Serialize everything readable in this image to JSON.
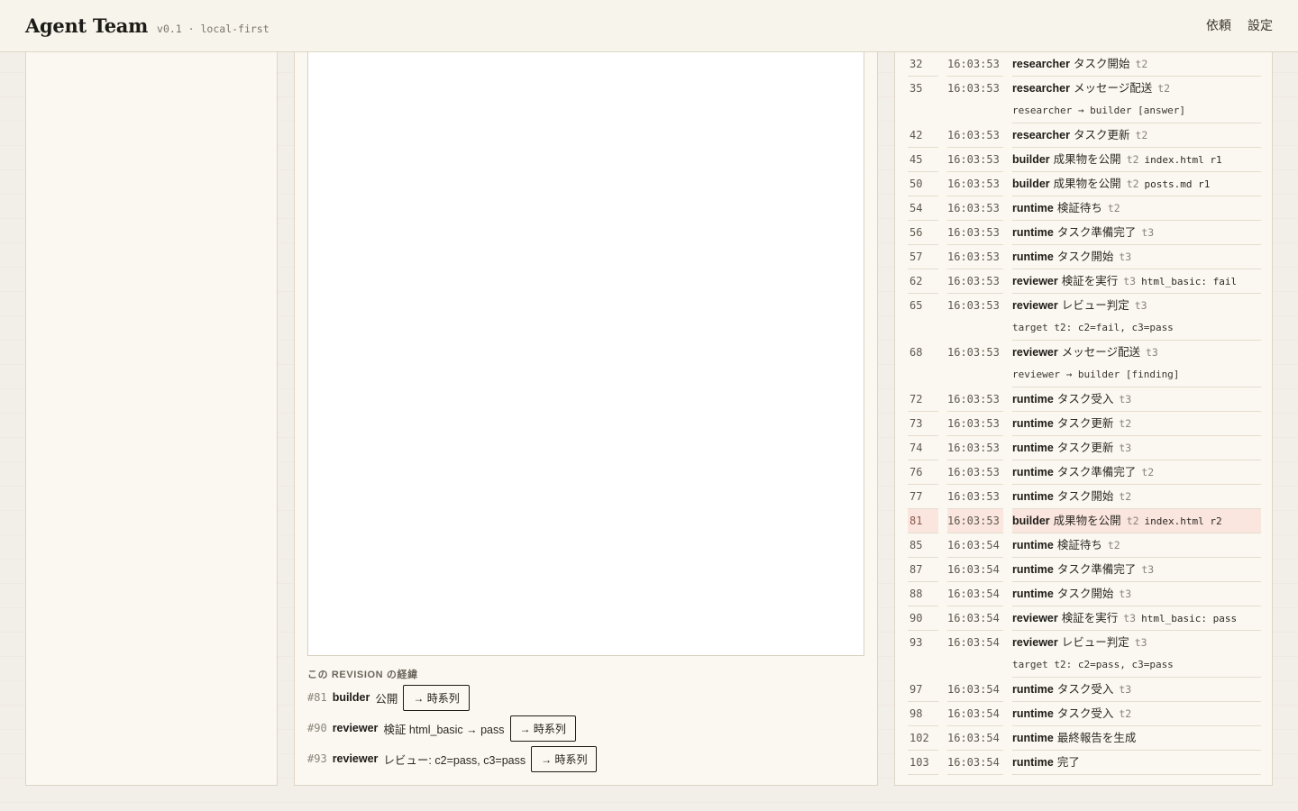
{
  "header": {
    "brand": "Agent Team",
    "version": "v0.1 · local-first",
    "nav": [
      "依頼",
      "設定"
    ]
  },
  "history": {
    "title": "この REVISION の経緯",
    "items": [
      {
        "num": "#81",
        "actor": "builder",
        "desc": "公開",
        "button": "→ 時系列"
      },
      {
        "num": "#90",
        "actor": "reviewer",
        "desc": "検証 html_basic → pass",
        "button": "→ 時系列"
      },
      {
        "num": "#93",
        "actor": "reviewer",
        "desc": "レビュー: c2=pass, c3=pass",
        "button": "→ 時系列"
      }
    ]
  },
  "log": [
    {
      "seq": "32",
      "time": "16:03:53",
      "actor": "researcher",
      "action": "タスク開始",
      "task": "t2",
      "extra": "",
      "detail": ""
    },
    {
      "seq": "35",
      "time": "16:03:53",
      "actor": "researcher",
      "action": "メッセージ配送",
      "task": "t2",
      "extra": "",
      "detail": "researcher → builder [answer]"
    },
    {
      "seq": "42",
      "time": "16:03:53",
      "actor": "researcher",
      "action": "タスク更新",
      "task": "t2",
      "extra": "",
      "detail": ""
    },
    {
      "seq": "45",
      "time": "16:03:53",
      "actor": "builder",
      "action": "成果物を公開",
      "task": "t2",
      "extra": "index.html r1",
      "detail": ""
    },
    {
      "seq": "50",
      "time": "16:03:53",
      "actor": "builder",
      "action": "成果物を公開",
      "task": "t2",
      "extra": "posts.md r1",
      "detail": ""
    },
    {
      "seq": "54",
      "time": "16:03:53",
      "actor": "runtime",
      "action": "検証待ち",
      "task": "t2",
      "extra": "",
      "detail": ""
    },
    {
      "seq": "56",
      "time": "16:03:53",
      "actor": "runtime",
      "action": "タスク準備完了",
      "task": "t3",
      "extra": "",
      "detail": ""
    },
    {
      "seq": "57",
      "time": "16:03:53",
      "actor": "runtime",
      "action": "タスク開始",
      "task": "t3",
      "extra": "",
      "detail": ""
    },
    {
      "seq": "62",
      "time": "16:03:53",
      "actor": "reviewer",
      "action": "検証を実行",
      "task": "t3",
      "extra": "html_basic: fail",
      "detail": ""
    },
    {
      "seq": "65",
      "time": "16:03:53",
      "actor": "reviewer",
      "action": "レビュー判定",
      "task": "t3",
      "extra": "",
      "detail": "target t2: c2=fail, c3=pass"
    },
    {
      "seq": "68",
      "time": "16:03:53",
      "actor": "reviewer",
      "action": "メッセージ配送",
      "task": "t3",
      "extra": "",
      "detail": "reviewer → builder [finding]"
    },
    {
      "seq": "72",
      "time": "16:03:53",
      "actor": "runtime",
      "action": "タスク受入",
      "task": "t3",
      "extra": "",
      "detail": ""
    },
    {
      "seq": "73",
      "time": "16:03:53",
      "actor": "runtime",
      "action": "タスク更新",
      "task": "t2",
      "extra": "",
      "detail": ""
    },
    {
      "seq": "74",
      "time": "16:03:53",
      "actor": "runtime",
      "action": "タスク更新",
      "task": "t3",
      "extra": "",
      "detail": ""
    },
    {
      "seq": "76",
      "time": "16:03:53",
      "actor": "runtime",
      "action": "タスク準備完了",
      "task": "t2",
      "extra": "",
      "detail": ""
    },
    {
      "seq": "77",
      "time": "16:03:53",
      "actor": "runtime",
      "action": "タスク開始",
      "task": "t2",
      "extra": "",
      "detail": ""
    },
    {
      "seq": "81",
      "time": "16:03:53",
      "actor": "builder",
      "action": "成果物を公開",
      "task": "t2",
      "extra": "index.html r2",
      "detail": "",
      "highlight": true
    },
    {
      "seq": "85",
      "time": "16:03:54",
      "actor": "runtime",
      "action": "検証待ち",
      "task": "t2",
      "extra": "",
      "detail": ""
    },
    {
      "seq": "87",
      "time": "16:03:54",
      "actor": "runtime",
      "action": "タスク準備完了",
      "task": "t3",
      "extra": "",
      "detail": ""
    },
    {
      "seq": "88",
      "time": "16:03:54",
      "actor": "runtime",
      "action": "タスク開始",
      "task": "t3",
      "extra": "",
      "detail": ""
    },
    {
      "seq": "90",
      "time": "16:03:54",
      "actor": "reviewer",
      "action": "検証を実行",
      "task": "t3",
      "extra": "html_basic: pass",
      "detail": ""
    },
    {
      "seq": "93",
      "time": "16:03:54",
      "actor": "reviewer",
      "action": "レビュー判定",
      "task": "t3",
      "extra": "",
      "detail": "target t2: c2=pass, c3=pass"
    },
    {
      "seq": "97",
      "time": "16:03:54",
      "actor": "runtime",
      "action": "タスク受入",
      "task": "t3",
      "extra": "",
      "detail": ""
    },
    {
      "seq": "98",
      "time": "16:03:54",
      "actor": "runtime",
      "action": "タスク受入",
      "task": "t2",
      "extra": "",
      "detail": ""
    },
    {
      "seq": "102",
      "time": "16:03:54",
      "actor": "runtime",
      "action": "最終報告を生成",
      "task": "",
      "extra": "",
      "detail": ""
    },
    {
      "seq": "103",
      "time": "16:03:54",
      "actor": "runtime",
      "action": "完了",
      "task": "",
      "extra": "",
      "detail": ""
    }
  ]
}
